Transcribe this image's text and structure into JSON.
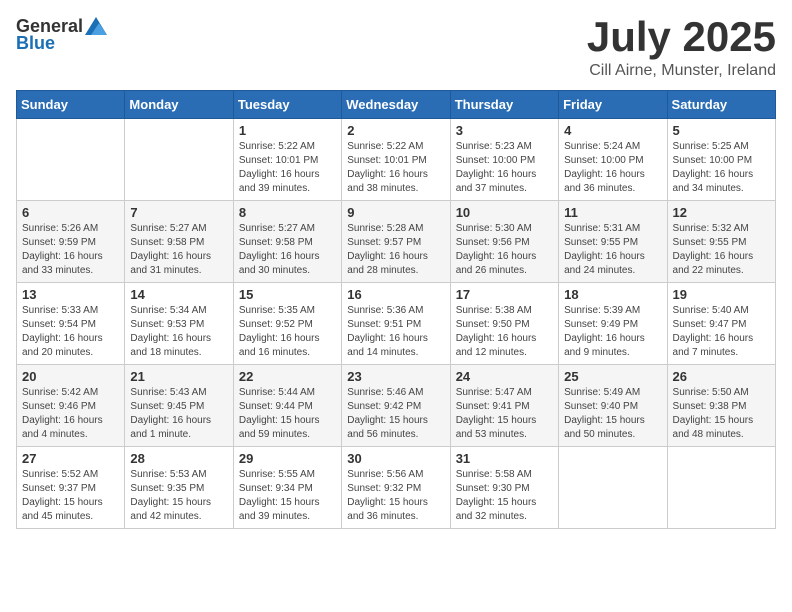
{
  "header": {
    "logo_general": "General",
    "logo_blue": "Blue",
    "month_title": "July 2025",
    "subtitle": "Cill Airne, Munster, Ireland"
  },
  "weekdays": [
    "Sunday",
    "Monday",
    "Tuesday",
    "Wednesday",
    "Thursday",
    "Friday",
    "Saturday"
  ],
  "weeks": [
    [
      {
        "day": "",
        "info": ""
      },
      {
        "day": "",
        "info": ""
      },
      {
        "day": "1",
        "info": "Sunrise: 5:22 AM\nSunset: 10:01 PM\nDaylight: 16 hours and 39 minutes."
      },
      {
        "day": "2",
        "info": "Sunrise: 5:22 AM\nSunset: 10:01 PM\nDaylight: 16 hours and 38 minutes."
      },
      {
        "day": "3",
        "info": "Sunrise: 5:23 AM\nSunset: 10:00 PM\nDaylight: 16 hours and 37 minutes."
      },
      {
        "day": "4",
        "info": "Sunrise: 5:24 AM\nSunset: 10:00 PM\nDaylight: 16 hours and 36 minutes."
      },
      {
        "day": "5",
        "info": "Sunrise: 5:25 AM\nSunset: 10:00 PM\nDaylight: 16 hours and 34 minutes."
      }
    ],
    [
      {
        "day": "6",
        "info": "Sunrise: 5:26 AM\nSunset: 9:59 PM\nDaylight: 16 hours and 33 minutes."
      },
      {
        "day": "7",
        "info": "Sunrise: 5:27 AM\nSunset: 9:58 PM\nDaylight: 16 hours and 31 minutes."
      },
      {
        "day": "8",
        "info": "Sunrise: 5:27 AM\nSunset: 9:58 PM\nDaylight: 16 hours and 30 minutes."
      },
      {
        "day": "9",
        "info": "Sunrise: 5:28 AM\nSunset: 9:57 PM\nDaylight: 16 hours and 28 minutes."
      },
      {
        "day": "10",
        "info": "Sunrise: 5:30 AM\nSunset: 9:56 PM\nDaylight: 16 hours and 26 minutes."
      },
      {
        "day": "11",
        "info": "Sunrise: 5:31 AM\nSunset: 9:55 PM\nDaylight: 16 hours and 24 minutes."
      },
      {
        "day": "12",
        "info": "Sunrise: 5:32 AM\nSunset: 9:55 PM\nDaylight: 16 hours and 22 minutes."
      }
    ],
    [
      {
        "day": "13",
        "info": "Sunrise: 5:33 AM\nSunset: 9:54 PM\nDaylight: 16 hours and 20 minutes."
      },
      {
        "day": "14",
        "info": "Sunrise: 5:34 AM\nSunset: 9:53 PM\nDaylight: 16 hours and 18 minutes."
      },
      {
        "day": "15",
        "info": "Sunrise: 5:35 AM\nSunset: 9:52 PM\nDaylight: 16 hours and 16 minutes."
      },
      {
        "day": "16",
        "info": "Sunrise: 5:36 AM\nSunset: 9:51 PM\nDaylight: 16 hours and 14 minutes."
      },
      {
        "day": "17",
        "info": "Sunrise: 5:38 AM\nSunset: 9:50 PM\nDaylight: 16 hours and 12 minutes."
      },
      {
        "day": "18",
        "info": "Sunrise: 5:39 AM\nSunset: 9:49 PM\nDaylight: 16 hours and 9 minutes."
      },
      {
        "day": "19",
        "info": "Sunrise: 5:40 AM\nSunset: 9:47 PM\nDaylight: 16 hours and 7 minutes."
      }
    ],
    [
      {
        "day": "20",
        "info": "Sunrise: 5:42 AM\nSunset: 9:46 PM\nDaylight: 16 hours and 4 minutes."
      },
      {
        "day": "21",
        "info": "Sunrise: 5:43 AM\nSunset: 9:45 PM\nDaylight: 16 hours and 1 minute."
      },
      {
        "day": "22",
        "info": "Sunrise: 5:44 AM\nSunset: 9:44 PM\nDaylight: 15 hours and 59 minutes."
      },
      {
        "day": "23",
        "info": "Sunrise: 5:46 AM\nSunset: 9:42 PM\nDaylight: 15 hours and 56 minutes."
      },
      {
        "day": "24",
        "info": "Sunrise: 5:47 AM\nSunset: 9:41 PM\nDaylight: 15 hours and 53 minutes."
      },
      {
        "day": "25",
        "info": "Sunrise: 5:49 AM\nSunset: 9:40 PM\nDaylight: 15 hours and 50 minutes."
      },
      {
        "day": "26",
        "info": "Sunrise: 5:50 AM\nSunset: 9:38 PM\nDaylight: 15 hours and 48 minutes."
      }
    ],
    [
      {
        "day": "27",
        "info": "Sunrise: 5:52 AM\nSunset: 9:37 PM\nDaylight: 15 hours and 45 minutes."
      },
      {
        "day": "28",
        "info": "Sunrise: 5:53 AM\nSunset: 9:35 PM\nDaylight: 15 hours and 42 minutes."
      },
      {
        "day": "29",
        "info": "Sunrise: 5:55 AM\nSunset: 9:34 PM\nDaylight: 15 hours and 39 minutes."
      },
      {
        "day": "30",
        "info": "Sunrise: 5:56 AM\nSunset: 9:32 PM\nDaylight: 15 hours and 36 minutes."
      },
      {
        "day": "31",
        "info": "Sunrise: 5:58 AM\nSunset: 9:30 PM\nDaylight: 15 hours and 32 minutes."
      },
      {
        "day": "",
        "info": ""
      },
      {
        "day": "",
        "info": ""
      }
    ]
  ]
}
